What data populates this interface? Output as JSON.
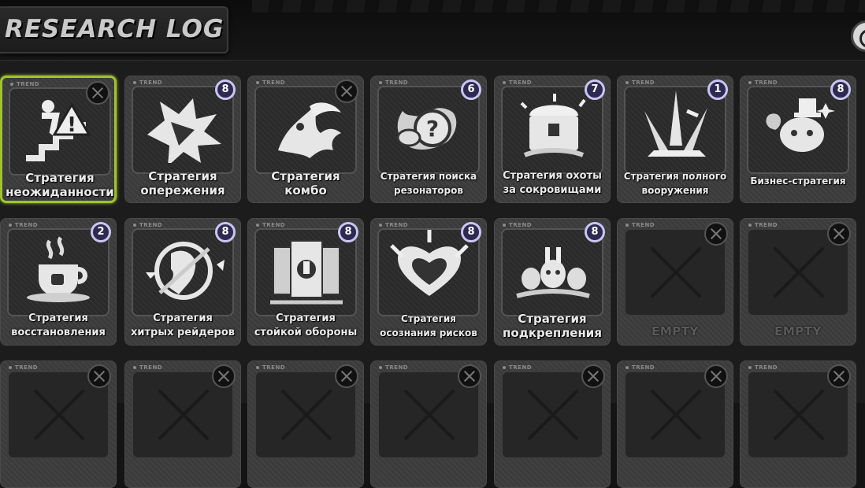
{
  "header": {
    "title": "RESEARCH LOG"
  },
  "card_tag": "TREND",
  "strategies": [
    {
      "line1": "Стратегия",
      "line2": "неожиданности",
      "badge": "",
      "selected": true,
      "icon": "stairs-warning-icon"
    },
    {
      "line1": "Стратегия",
      "line2": "опережения",
      "badge": "8",
      "icon": "shatter-burst-icon"
    },
    {
      "line1": "Стратегия",
      "line2": "комбо",
      "badge": "",
      "icon": "dragon-flame-icon"
    },
    {
      "line1": "Стратегия поиска",
      "line2": "резонаторов",
      "badge": "6",
      "icon": "mystery-coins-icon"
    },
    {
      "line1": "Стратегия охоты",
      "line2": "за сокровищами",
      "badge": "7",
      "icon": "treasure-chest-icon"
    },
    {
      "line1": "Стратегия полного",
      "line2": "вооружения",
      "badge": "1",
      "icon": "weapons-cluster-icon"
    },
    {
      "line1": "Бизнес-стратегия",
      "line2": "",
      "badge": "8",
      "icon": "rabbit-hat-icon"
    },
    {
      "line1": "Стратегия",
      "line2": "восстановления",
      "badge": "2",
      "icon": "coffee-cup-icon"
    },
    {
      "line1": "Стратегия",
      "line2": "хитрых рейдеров",
      "badge": "8",
      "icon": "raider-head-icon"
    },
    {
      "line1": "Стратегия",
      "line2": "стойкой обороны",
      "badge": "8",
      "icon": "shield-speakers-icon"
    },
    {
      "line1": "Стратегия",
      "line2": "осознания рисков",
      "badge": "8",
      "icon": "heart-spikes-icon"
    },
    {
      "line1": "Стратегия",
      "line2": "подкрепления",
      "badge": "8",
      "icon": "rabbit-squad-icon"
    }
  ],
  "empty_label": "EMPTY"
}
